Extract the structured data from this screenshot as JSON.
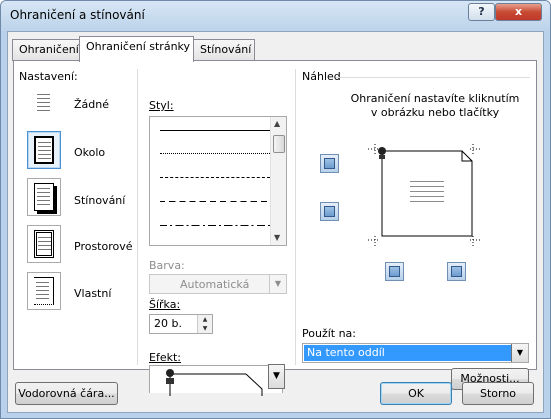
{
  "window": {
    "title": "Ohraničení a stínování",
    "help_button": "?",
    "close_button": "x"
  },
  "tabs": [
    {
      "label": "Ohraničení",
      "active": false
    },
    {
      "label": "Ohraničení stránky",
      "active": true
    },
    {
      "label": "Stínování",
      "active": false
    }
  ],
  "settings": {
    "label": "Nastavení:",
    "items": [
      {
        "label": "Žádné",
        "selected": false
      },
      {
        "label": "Okolo",
        "selected": true
      },
      {
        "label": "Stínování",
        "selected": false
      },
      {
        "label": "Prostorové",
        "selected": false
      },
      {
        "label": "Vlastní",
        "selected": false
      }
    ]
  },
  "style": {
    "label": "Styl:",
    "line_styles": [
      "solid",
      "dotted",
      "dashed-small",
      "dashed",
      "dash-dot"
    ]
  },
  "color": {
    "label": "Barva:",
    "value": "Automatická",
    "enabled": false
  },
  "width": {
    "label": "Šířka:",
    "value": "20 b."
  },
  "effect": {
    "label": "Efekt:"
  },
  "preview": {
    "label": "Náhled",
    "hint_line1": "Ohraničení nastavíte kliknutím",
    "hint_line2": "v obrázku nebo tlačítky"
  },
  "apply_to": {
    "label": "Použít na:",
    "value": "Na tento oddíl"
  },
  "buttons": {
    "options": "Možnosti...",
    "horizontal_line": "Vodorovná čára...",
    "ok": "OK",
    "cancel": "Storno"
  },
  "colors": {
    "title_bar": "#c6d9ee",
    "close_button": "#c74a33",
    "selection": "#3399ff"
  }
}
